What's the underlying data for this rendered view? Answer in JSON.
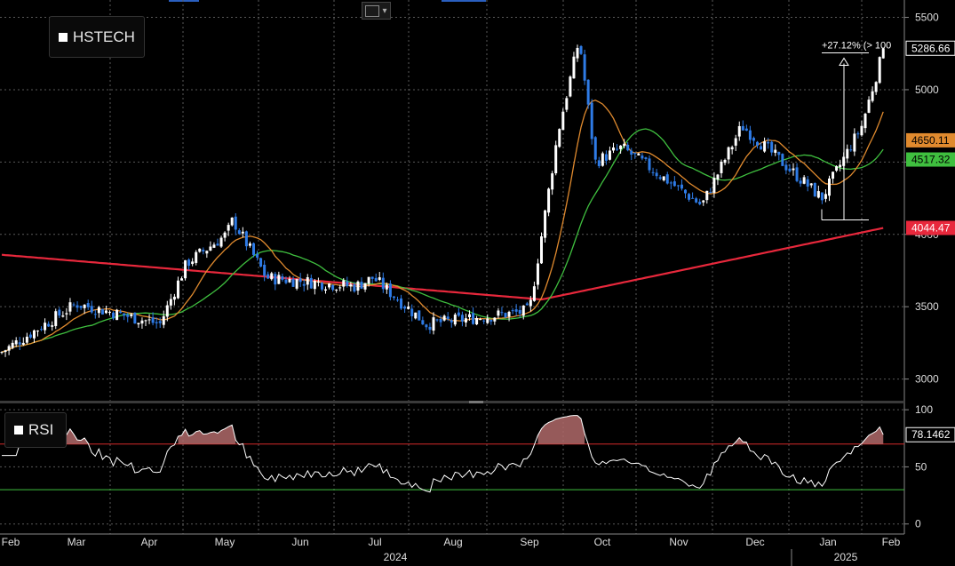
{
  "toolbar": {
    "chart_style_icon": "line-chart-icon",
    "dropdown_icon": "caret-down-icon"
  },
  "colors": {
    "background": "#000000",
    "grid": "#5a5a5a",
    "candle_up": "#ffffff",
    "candle_down": "#2e7be6",
    "ma_orange": "#e08a2e",
    "ma_green": "#3fbf3f",
    "ma_red": "#e8283c",
    "rsi_line": "#ffffff",
    "rsi_upper": "#d42b2b",
    "rsi_lower": "#3fbf3f",
    "rsi_overbought_fill": "#b06a6a"
  },
  "chart_data": [
    {
      "type": "candlestick",
      "legend": "HSTECH",
      "x_ticks": [
        "Feb",
        "Mar",
        "Apr",
        "May",
        "Jun",
        "Jul",
        "Aug",
        "Sep",
        "Oct",
        "Nov",
        "Dec",
        "Jan",
        "Feb"
      ],
      "year_labels": [
        "2024",
        "2025"
      ],
      "y_ticks": [
        3000,
        3500,
        4000,
        4500,
        5000,
        5500
      ],
      "ylim": [
        2850,
        5620
      ],
      "grid": true,
      "series": [
        {
          "kind": "candles",
          "anchors_monthly_close": [
            [
              "Feb",
              3180
            ],
            [
              "Mar",
              3520
            ],
            [
              "Apr",
              3380
            ],
            [
              "Apr-late",
              3800
            ],
            [
              "May",
              4000
            ],
            [
              "May-mid",
              4100
            ],
            [
              "Jun",
              3700
            ],
            [
              "Jul",
              3640
            ],
            [
              "Jul-mid",
              3700
            ],
            [
              "Aug",
              3380
            ],
            [
              "Sep",
              3470
            ],
            [
              "Sep-late",
              4700
            ],
            [
              "Oct",
              5350
            ],
            [
              "Oct-mid",
              4500
            ],
            [
              "Nov",
              4600
            ],
            [
              "Nov-mid",
              4200
            ],
            [
              "Dec",
              4750
            ],
            [
              "Dec-mid",
              4500
            ],
            [
              "Jan",
              4250
            ],
            [
              "Jan-mid",
              4750
            ],
            [
              "Feb",
              5286.66
            ]
          ]
        },
        {
          "kind": "line",
          "color": "#e08a2e",
          "last_value": "4650.11"
        },
        {
          "kind": "line",
          "color": "#3fbf3f",
          "last_value": "4517.32"
        },
        {
          "kind": "line",
          "color": "#e8283c",
          "last_value": "4044.47"
        }
      ],
      "last_price": "5286.66",
      "annotation": {
        "text": "+27.12% (> 100",
        "from": 4100,
        "to": 5230
      }
    },
    {
      "type": "line",
      "legend": "RSI",
      "y_ticks": [
        0,
        50,
        100
      ],
      "ylim": [
        -8,
        104
      ],
      "upper_band": 70,
      "lower_band": 30,
      "last_value": "78.1462",
      "grid": true
    }
  ]
}
